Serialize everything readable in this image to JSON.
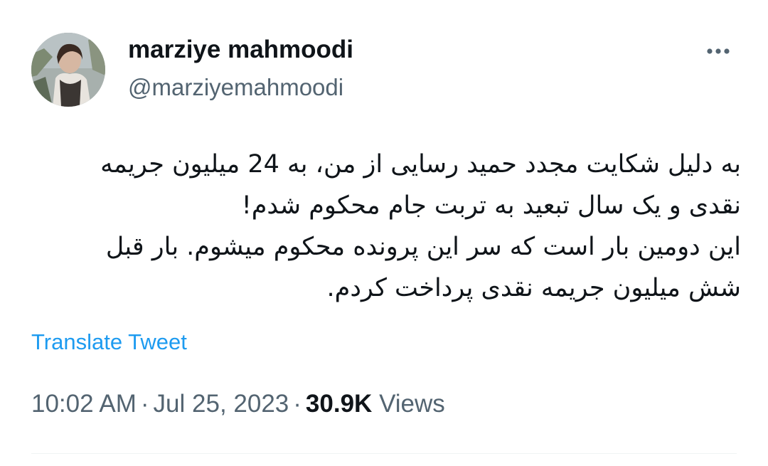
{
  "author": {
    "display_name": "marziye mahmoodi",
    "handle": "@marziyemahmoodi",
    "avatar_icon": "profile-photo"
  },
  "tweet": {
    "text_lines": [
      "به دلیل شکایت مجدد حمید رسایی از من، به 24 میلیون جریمه",
      "نقدی و یک سال تبعید به تربت جام محکوم شدم!",
      "این دومین بار است که سر این پرونده محکوم میشوم. بار قبل",
      "شش میلیون جریمه نقدی پرداخت کردم."
    ],
    "translate_label": "Translate Tweet"
  },
  "meta": {
    "time": "10:02 AM",
    "separator": "·",
    "date": "Jul 25, 2023",
    "views_count": "30.9K",
    "views_label": "Views"
  },
  "colors": {
    "text_primary": "#0f1419",
    "text_secondary": "#536471",
    "link": "#1d9bf0",
    "divider": "#eff3f4"
  }
}
